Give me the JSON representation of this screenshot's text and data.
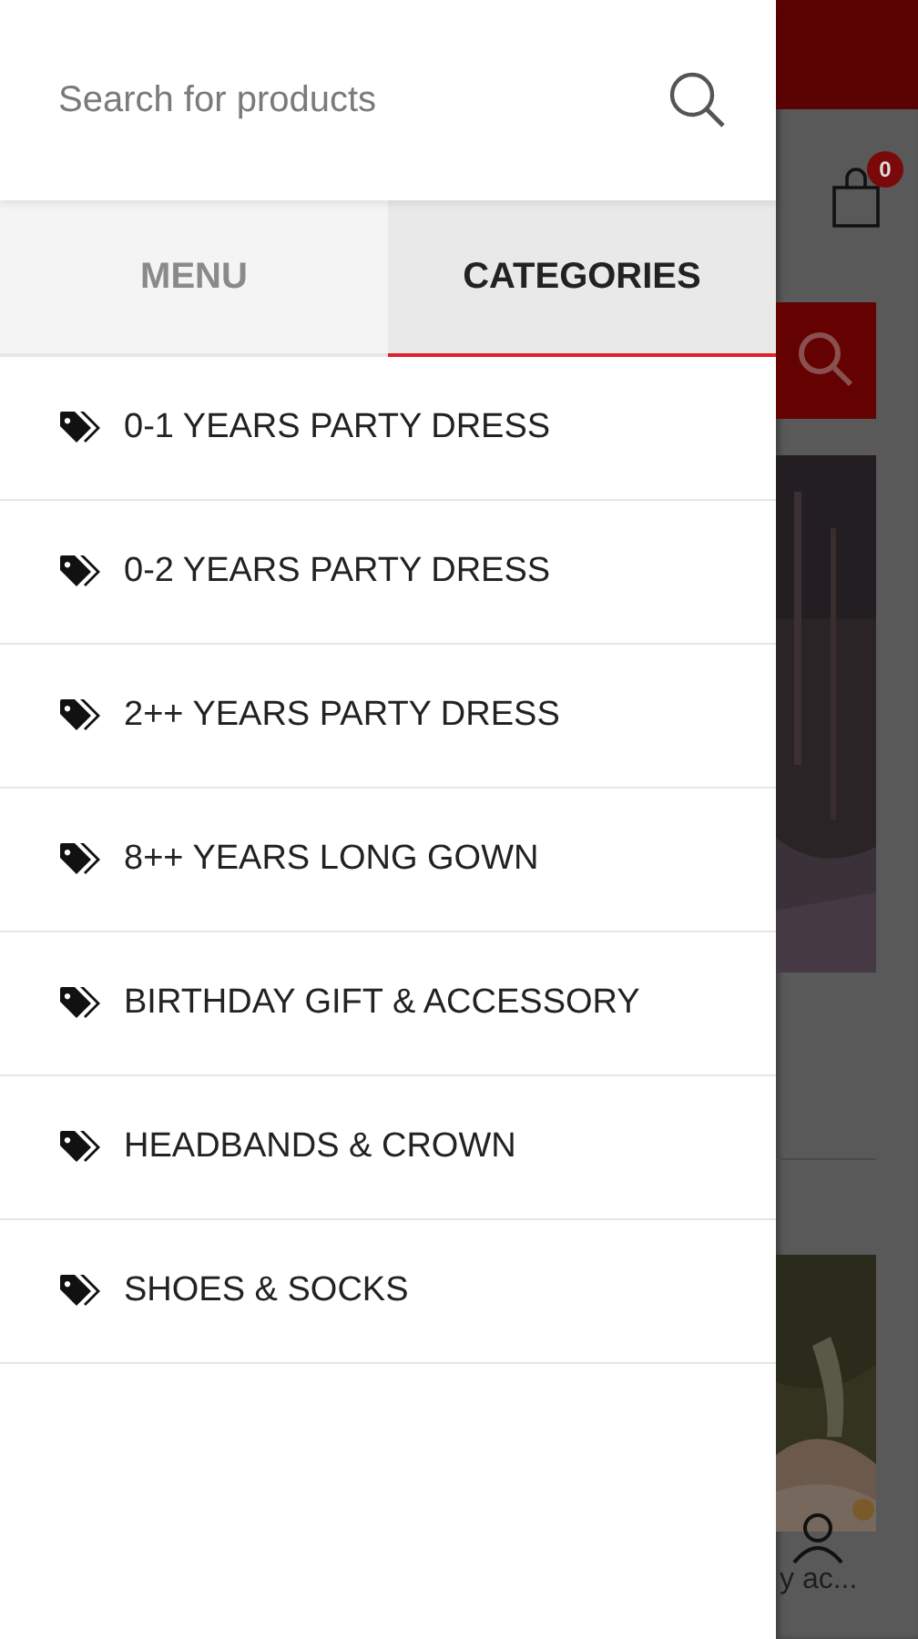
{
  "search": {
    "placeholder": "Search for products"
  },
  "tabs": [
    {
      "label": "MENU",
      "selected": false
    },
    {
      "label": "CATEGORIES",
      "selected": true
    }
  ],
  "categories": [
    {
      "label": "0-1 YEARS PARTY DRESS"
    },
    {
      "label": "0-2 YEARS PARTY DRESS"
    },
    {
      "label": "2++ YEARS PARTY DRESS"
    },
    {
      "label": "8++ YEARS LONG GOWN"
    },
    {
      "label": "BIRTHDAY GIFT & ACCESSORY"
    },
    {
      "label": "HEADBANDS & CROWN"
    },
    {
      "label": "SHOES & SOCKS"
    }
  ],
  "background_page": {
    "cart_count": "0",
    "account_label": "y ac..."
  }
}
